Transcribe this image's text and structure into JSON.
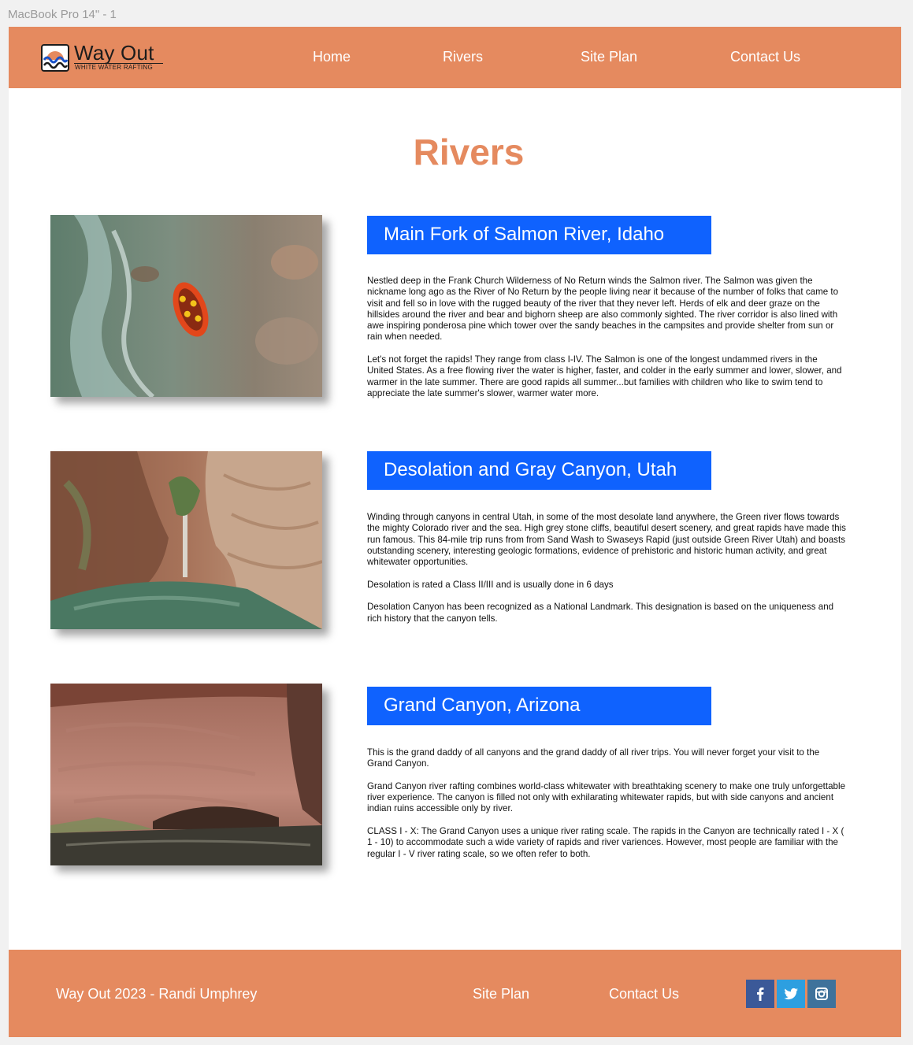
{
  "frame_label": "MacBook Pro 14\" - 1",
  "brand": {
    "name": "Way Out",
    "tagline": "WHITE WATER RAFTING"
  },
  "nav": {
    "home": "Home",
    "rivers": "Rivers",
    "site_plan": "Site Plan",
    "contact": "Contact Us"
  },
  "page_title": "Rivers",
  "rivers": [
    {
      "heading": "Main Fork of Salmon River, Idaho",
      "photo": "aerial-raft-photo",
      "paragraphs": [
        "Nestled deep in the Frank Church Wilderness of No Return winds the Salmon river. The Salmon was given the nickname long ago as the River of No Return by the people living near it because of the number of folks that came to visit and fell so in love with the rugged beauty of the river that they never left. Herds of elk and deer graze on the hillsides around the river and bear and bighorn sheep are also commonly sighted. The river corridor is also lined with awe inspiring ponderosa pine which tower over the sandy beaches in the campsites and provide shelter from sun or rain when needed.",
        "Let's not forget the rapids! They range from class I-IV. The Salmon is one of the longest undammed rivers in the United States. As a free flowing river the water is higher, faster, and colder in the early summer and lower, slower, and warmer in the late summer. There are good rapids all summer...but families with children who like to swim tend to appreciate the late summer's slower, warmer water more."
      ]
    },
    {
      "heading": "Desolation and Gray Canyon, Utah",
      "photo": "canyon-waterfall-photo",
      "paragraphs": [
        "Winding through canyons in central Utah, in some of the most desolate land anywhere, the Green river flows towards the mighty Colorado river and the sea. High grey stone cliffs, beautiful desert scenery, and great rapids have made this run famous. This 84-mile trip runs from from Sand Wash to Swaseys Rapid (just outside Green River Utah) and boasts outstanding scenery, interesting geologic formations, evidence of prehistoric and historic human activity, and great whitewater opportunities.",
        "Desolation is rated a Class II/III and is usually done in 6 days",
        "Desolation Canyon has been recognized as a National Landmark. This designation is based on the uniqueness and rich history that the canyon tells."
      ]
    },
    {
      "heading": "Grand Canyon, Arizona",
      "photo": "canyon-wall-river-photo",
      "paragraphs": [
        "This is the grand daddy of all canyons and the grand daddy of all river trips. You will never forget your visit to the Grand Canyon.",
        "Grand Canyon river rafting combines world-class whitewater with breathtaking scenery to make one truly unforgettable river experience. The canyon is filled not only with exhilarating whitewater rapids, but with side canyons and ancient indian ruins accessible only by river.",
        "CLASS I - X: The Grand Canyon uses a unique river rating scale. The rapids in the Canyon are technically rated I - X ( 1 - 10) to accommodate such a wide variety of rapids and river variences. However, most people are familiar with the regular I - V river rating scale, so we often refer to both."
      ]
    }
  ],
  "footer": {
    "credit": "Way Out 2023 - Randi Umphrey",
    "site_plan": "Site Plan",
    "contact": "Contact Us",
    "social": [
      {
        "icon": "facebook-icon",
        "color": "#3b5998"
      },
      {
        "icon": "twitter-icon",
        "color": "#2d9fe0"
      },
      {
        "icon": "instagram-icon",
        "color": "#3f729b"
      }
    ]
  },
  "colors": {
    "accent": "#e58a5f",
    "heading_bar": "#0f62fe"
  }
}
